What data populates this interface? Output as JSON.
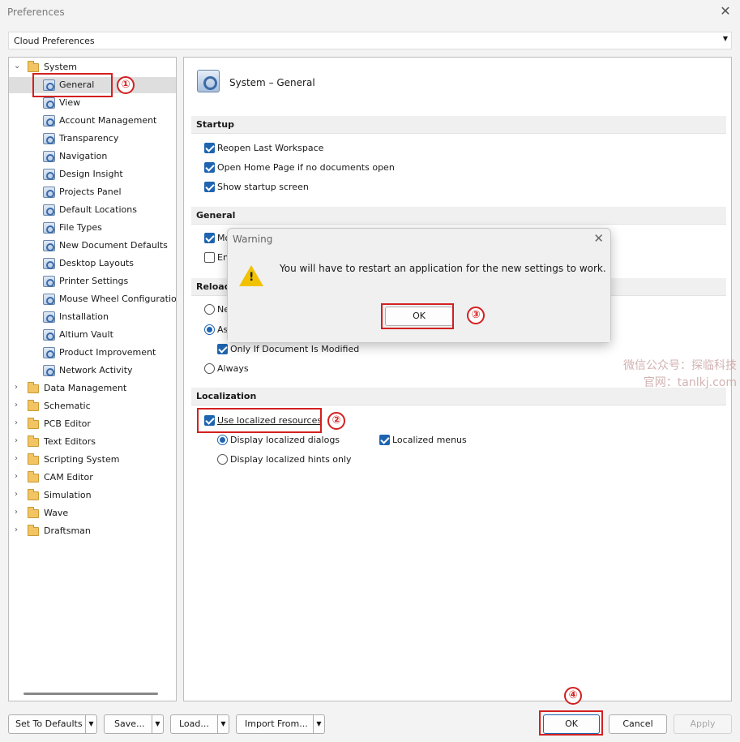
{
  "window": {
    "title": "Preferences"
  },
  "profile": {
    "value": "Cloud Preferences"
  },
  "tree": {
    "root_label": "System",
    "children": [
      "General",
      "View",
      "Account Management",
      "Transparency",
      "Navigation",
      "Design Insight",
      "Projects Panel",
      "Default Locations",
      "File Types",
      "New Document Defaults",
      "Desktop Layouts",
      "Printer Settings",
      "Mouse Wheel Configuration",
      "Installation",
      "Altium Vault",
      "Product Improvement",
      "Network Activity"
    ],
    "groups": [
      "Data Management",
      "Schematic",
      "PCB Editor",
      "Text Editors",
      "Scripting System",
      "CAM Editor",
      "Simulation",
      "Wave",
      "Draftsman"
    ]
  },
  "page": {
    "title": "System – General",
    "startup": {
      "heading": "Startup",
      "reopen": "Reopen Last Workspace",
      "home": "Open Home Page if no documents open",
      "splash": "Show startup screen"
    },
    "general": {
      "heading": "General",
      "opt1": "Mo",
      "opt2": "En"
    },
    "reload": {
      "heading": "Reload",
      "never": "Ne",
      "ask": "As",
      "only_modified": "Only If Document Is Modified",
      "always": "Always"
    },
    "localization": {
      "heading": "Localization",
      "use_localized": "Use localized resources",
      "dialogs": "Display localized dialogs",
      "hints": "Display localized hints only",
      "menus": "Localized menus"
    }
  },
  "dialog": {
    "title": "Warning",
    "message": "You will have to restart an application for the new settings to work.",
    "ok": "OK"
  },
  "buttons": {
    "set_defaults": "Set To Defaults",
    "save": "Save...",
    "load": "Load...",
    "import": "Import From...",
    "ok": "OK",
    "cancel": "Cancel",
    "apply": "Apply"
  },
  "markers": [
    "①",
    "②",
    "③",
    "④"
  ],
  "watermark": {
    "line1": "微信公众号：探临科技",
    "line2": "官网：tanlkj.com"
  },
  "colors": {
    "accent": "#1f64b0",
    "highlight_box": "#d32020"
  }
}
